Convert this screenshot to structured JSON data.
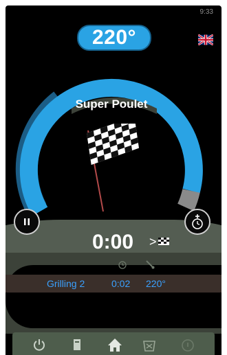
{
  "status": {
    "clock": "9:33"
  },
  "header": {
    "temperature": "220°",
    "language_flag": "uk-flag-icon"
  },
  "program": {
    "name": "Super Poulet",
    "progress": 0.82,
    "image": "checkered-flag-icon"
  },
  "timer": {
    "time": "0:00",
    "arrow": ">"
  },
  "step": {
    "name": "Grilling 2",
    "time": "0:02",
    "temp": "220°"
  },
  "colors": {
    "arc": "#2aa3e4",
    "arc_remaining": "#8a8a8a",
    "step_text": "#3aa1ff",
    "panel": "#3c4239",
    "nav": "#4e5d4c"
  },
  "nav": {
    "items": [
      "power-icon",
      "book-icon",
      "home-icon",
      "basket-icon",
      "lock-icon"
    ]
  }
}
